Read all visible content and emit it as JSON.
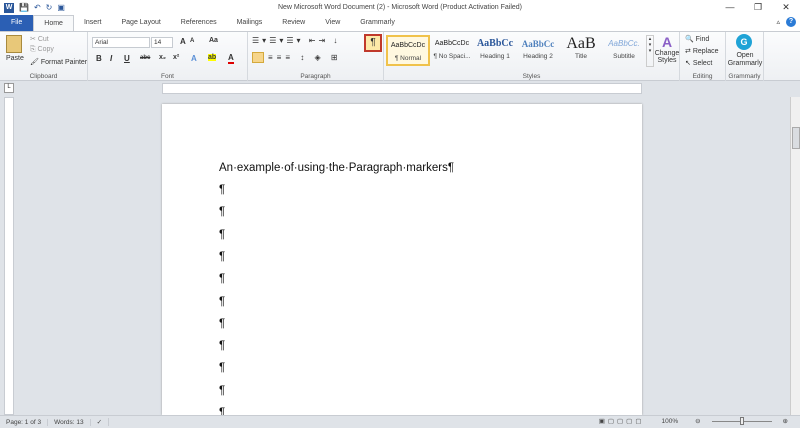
{
  "window": {
    "title": "New Microsoft Word Document (2)  -  Microsoft Word (Product Activation Failed)",
    "minimize": "—",
    "restore": "❐",
    "close": "✕"
  },
  "qat": {
    "word_icon": "W",
    "save": "💾",
    "undo": "↶",
    "redo": "↻",
    "print": "▣"
  },
  "tabs": [
    "File",
    "Home",
    "Insert",
    "Page Layout",
    "References",
    "Mailings",
    "Review",
    "View",
    "Grammarly"
  ],
  "ribbon": {
    "clipboard": {
      "label": "Clipboard",
      "paste": "Paste",
      "cut": "Cut",
      "copy": "Copy",
      "format_painter": "Format Painter"
    },
    "font": {
      "label": "Font",
      "name": "Arial",
      "size": "14",
      "bold": "B",
      "italic": "I",
      "underline": "U",
      "strike": "abc",
      "sub": "x₂",
      "sup": "x²",
      "grow": "A",
      "shrink": "A",
      "case": "Aa",
      "color": "A"
    },
    "paragraph": {
      "label": "Paragraph",
      "show_marks": "¶"
    },
    "styles": {
      "label": "Styles",
      "items": [
        {
          "preview": "AaBbCcDc",
          "name": "¶ Normal"
        },
        {
          "preview": "AaBbCcDc",
          "name": "¶ No Spaci..."
        },
        {
          "preview": "AaBbCc",
          "name": "Heading 1"
        },
        {
          "preview": "AaBbCc",
          "name": "Heading 2"
        },
        {
          "preview": "AaB",
          "name": "Title"
        },
        {
          "preview": "AaBbCc.",
          "name": "Subtitle"
        }
      ],
      "change_styles": "Change Styles"
    },
    "editing": {
      "label": "Editing",
      "find": "Find",
      "replace": "Replace",
      "select": "Select"
    },
    "grammarly": {
      "label": "Grammarly",
      "open": "Open Grammarly"
    }
  },
  "document": {
    "heading": "An·example·of·using·the·Paragraph·markers¶",
    "mark": "¶",
    "empty_lines": 11
  },
  "status": {
    "page": "Page: 1 of 3",
    "words": "Words: 13",
    "zoom": "100%"
  }
}
